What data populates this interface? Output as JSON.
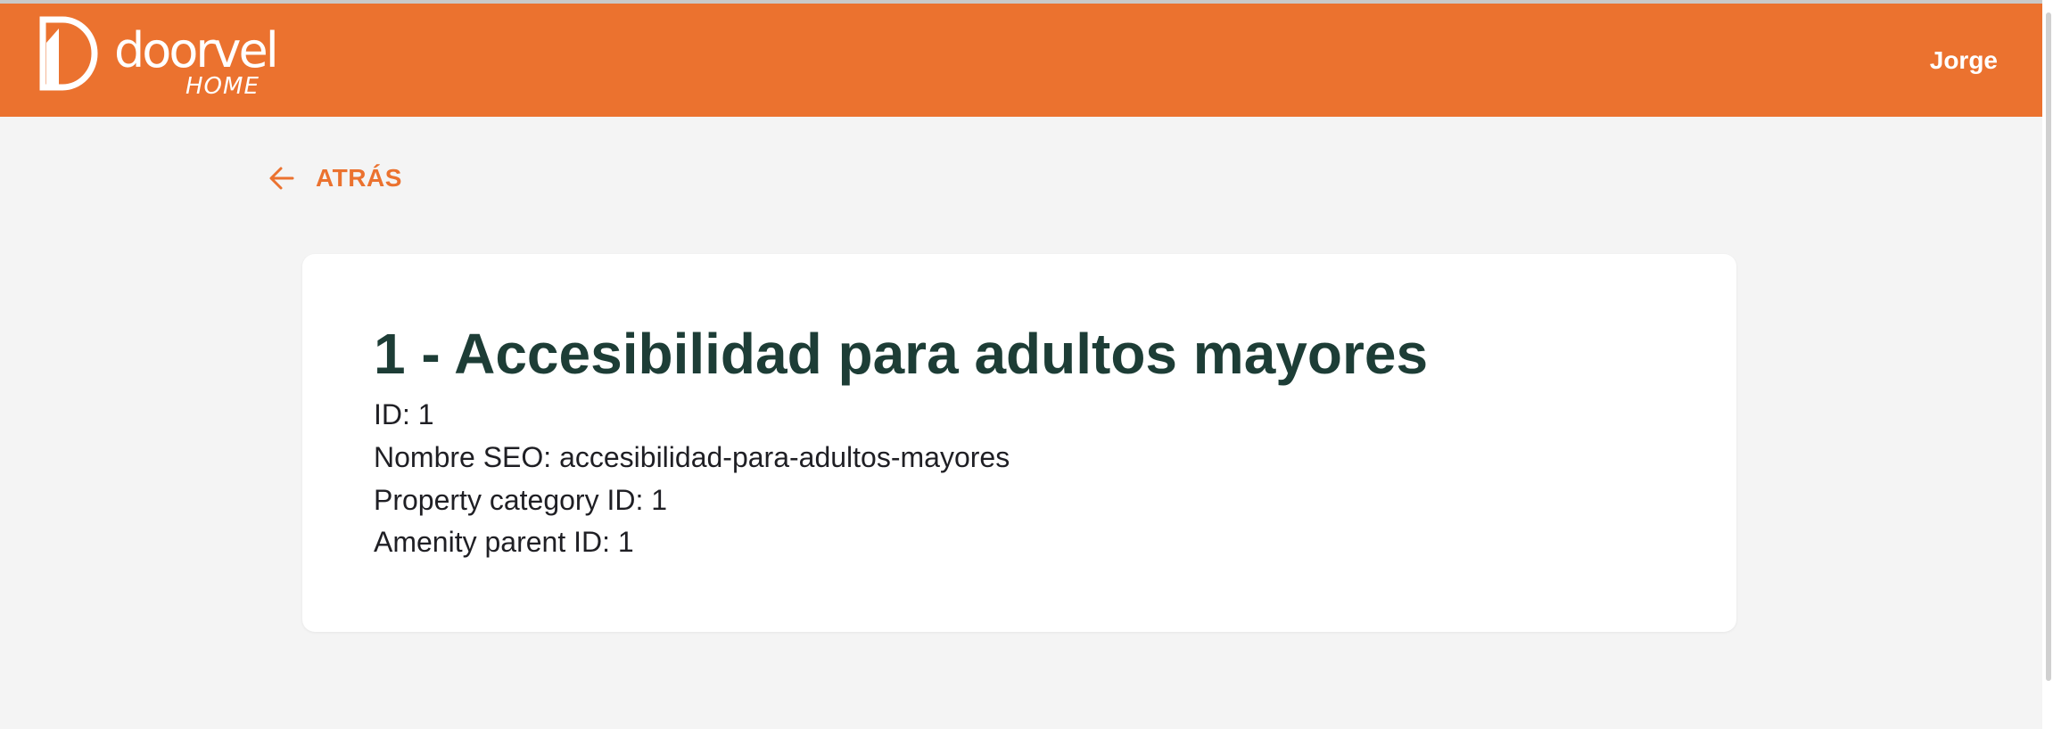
{
  "header": {
    "logo": {
      "word": "doorvel",
      "sub": "HOME"
    },
    "user_name": "Jorge",
    "brand_color": "#eb722f"
  },
  "back": {
    "label": "ATRÁS",
    "icon": "arrow-left-icon"
  },
  "detail": {
    "title": "1 - Accesibilidad para adultos mayores",
    "fields": [
      "ID: 1",
      "Nombre SEO: accesibilidad-para-adultos-mayores",
      "Property category ID: 1",
      "Amenity parent ID: 1"
    ]
  }
}
